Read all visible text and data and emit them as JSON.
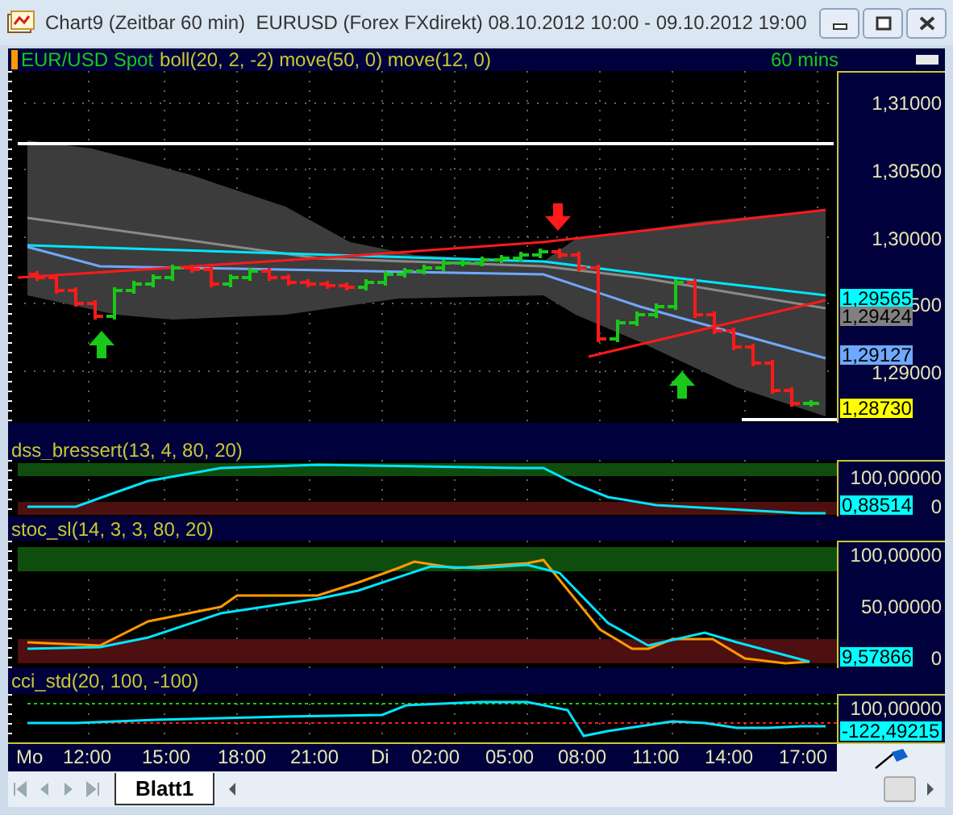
{
  "window": {
    "title": "Chart9 (Zeitbar 60 min)  EURUSD (Forex FXdirekt) 08.10.2012 10:00 - 09.10.2012 19:00"
  },
  "panels": [
    {
      "kind": "price",
      "legend": [
        {
          "text": "EUR/USD Spot",
          "color": "#19c819"
        },
        {
          "text": "boll(20, 2, -2) move(50, 0) move(12, 0)",
          "color": "#c8c832"
        }
      ],
      "timeframe": "60 mins",
      "axis_labels": [
        "1,31000",
        "1,30500",
        "1,30000",
        "500",
        "1,29000"
      ],
      "badges": [
        {
          "text": "1,29565",
          "color": "#00ffff"
        },
        {
          "text": "1,29424",
          "color": "#808080"
        },
        {
          "text": "1,29127",
          "color": "#6fa8ff"
        },
        {
          "text": "1,28730",
          "color": "#ffff00"
        }
      ]
    },
    {
      "kind": "dss",
      "legend": [
        {
          "text": "dss_bressert(13, 4, 80, 20)",
          "color": "#c8c832"
        }
      ],
      "axis_labels": [
        "100,00000",
        "0"
      ],
      "badges": [
        {
          "text": "0,88514",
          "color": "#00ffff"
        }
      ]
    },
    {
      "kind": "stochastic",
      "legend": [
        {
          "text": "stoc_sl(14, 3, 3, 80, 20)",
          "color": "#c8c832"
        }
      ],
      "axis_labels": [
        "100,00000",
        "50,00000",
        "0"
      ],
      "badges": [
        {
          "text": "9,57866",
          "color": "#00ffff"
        }
      ]
    },
    {
      "kind": "cci",
      "legend": [
        {
          "text": "cci_std(20, 100, -100)",
          "color": "#c8c832"
        }
      ],
      "axis_labels": [
        "100,00000"
      ],
      "badges": [
        {
          "text": "-122,49215",
          "color": "#00ffff"
        }
      ]
    }
  ],
  "time_axis": [
    "Mo",
    "12:00",
    "15:00",
    "18:00",
    "21:00",
    "Di",
    "02:00",
    "05:00",
    "08:00",
    "11:00",
    "14:00",
    "17:00"
  ],
  "sheet_tabs": [
    {
      "label": "Blatt1",
      "selected": true
    }
  ]
}
